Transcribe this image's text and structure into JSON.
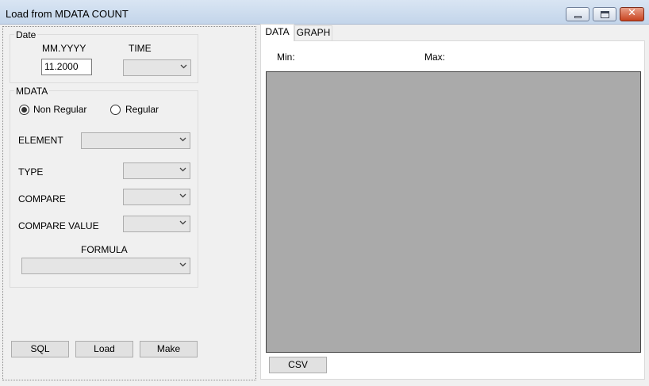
{
  "window": {
    "title": "Load from MDATA COUNT"
  },
  "date_group": {
    "label": "Date",
    "mm_yyyy_label": "MM.YYYY",
    "time_label": "TIME",
    "mm_yyyy_value": "11.2000",
    "time_value": ""
  },
  "mdata_group": {
    "label": "MDATA",
    "radio_non_regular": "Non Regular",
    "radio_regular": "Regular",
    "selected_radio": "Non Regular",
    "element_label": "ELEMENT",
    "type_label": "TYPE",
    "compare_label": "COMPARE",
    "compare_value_label": "COMPARE VALUE",
    "formula_label": "FORMULA",
    "element_value": "",
    "type_value": "",
    "compare_value": "",
    "compare_value_value": "",
    "formula_value": ""
  },
  "buttons": {
    "sql": "SQL",
    "load": "Load",
    "make": "Make",
    "csv": "CSV"
  },
  "tabs": {
    "data": "DATA",
    "graph": "GRAPH",
    "active": "DATA"
  },
  "data_page": {
    "min_label": "Min:",
    "max_label": "Max:"
  },
  "icons": {
    "chevron": "chevron-down-icon",
    "minimize": "minimize-icon",
    "maximize": "maximize-icon",
    "close": "close-icon"
  },
  "colors": {
    "titlebar": "#c3d5ea",
    "close_button": "#c8431f",
    "grid_background": "#aaaaaa",
    "window_background": "#f0f0f0"
  }
}
